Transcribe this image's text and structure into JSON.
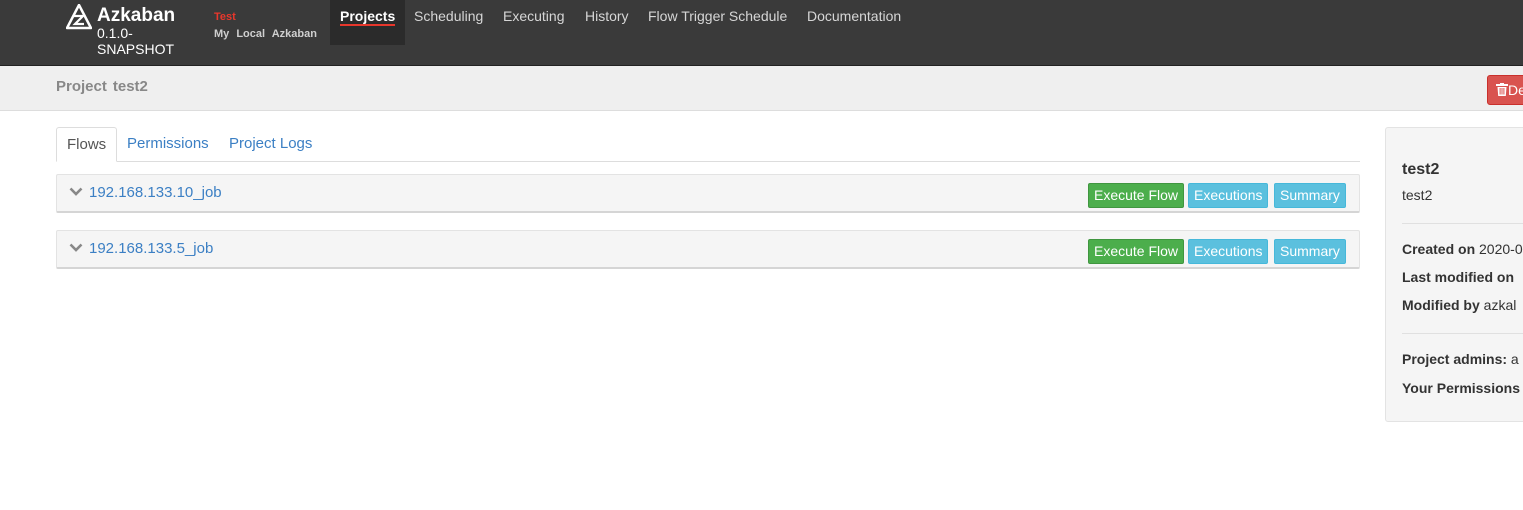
{
  "brand": {
    "name": "Azkaban",
    "version": "0.1.0-SNAPSHOT",
    "env_name": "Test",
    "env_desc": "My Local Azkaban"
  },
  "nav": {
    "items": [
      "Projects",
      "Scheduling",
      "Executing",
      "History",
      "Flow Trigger Schedule",
      "Documentation"
    ],
    "active": "Projects"
  },
  "header": {
    "label": "Project",
    "project_name": "test2",
    "delete_label": "Delete"
  },
  "tabs": [
    "Flows",
    "Permissions",
    "Project Logs"
  ],
  "flows": [
    {
      "name": "192.168.133.10_job",
      "execute_label": "Execute Flow",
      "executions_label": "Executions",
      "summary_label": "Summary"
    },
    {
      "name": "192.168.133.5_job",
      "execute_label": "Execute Flow",
      "executions_label": "Executions",
      "summary_label": "Summary"
    }
  ],
  "side": {
    "title": "test2",
    "description": "test2",
    "created_on_label": "Created on",
    "created_on_value": "2020-0",
    "last_modified_label": "Last modified on",
    "modified_by_label": "Modified by",
    "modified_by_value": "azkal",
    "admins_label": "Project admins:",
    "admins_value": "a",
    "permissions_label": "Your Permissions"
  },
  "colors": {
    "navbar": "#3a3a3a",
    "accent_red": "#e8372c",
    "link_blue": "#3b7fc4",
    "success_green": "#4cae4c",
    "info_blue": "#5bc0de",
    "danger_red": "#d9534f"
  },
  "icons": [
    "azkaban-logo-icon",
    "chevron-down-icon",
    "trash-icon"
  ]
}
